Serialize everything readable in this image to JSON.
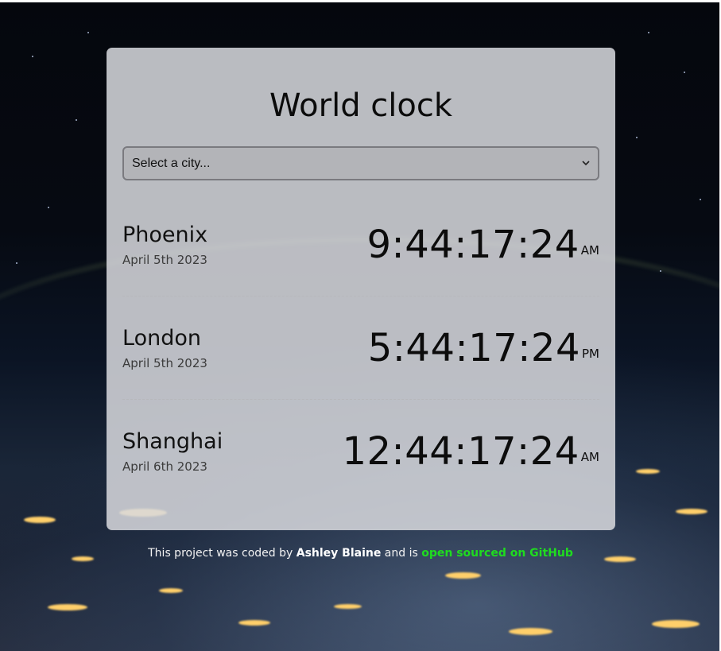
{
  "app": {
    "title": "World clock"
  },
  "select": {
    "placeholder": "Select a city..."
  },
  "cities": [
    {
      "name": "Phoenix",
      "date": "April 5th 2023",
      "time": "9:44:17:24",
      "ampm": "AM"
    },
    {
      "name": "London",
      "date": "April 5th 2023",
      "time": "5:44:17:24",
      "ampm": "PM"
    },
    {
      "name": "Shanghai",
      "date": "April 6th 2023",
      "time": "12:44:17:24",
      "ampm": "AM"
    }
  ],
  "footer": {
    "prefix": "This project was coded by",
    "author": "Ashley Blaine",
    "middle": "and is",
    "link_text": "open sourced on GitHub"
  },
  "colors": {
    "card_bg": "#d8dade",
    "link": "#1fdc1f"
  },
  "icons": {
    "dropdown": "chevron-down-icon"
  }
}
